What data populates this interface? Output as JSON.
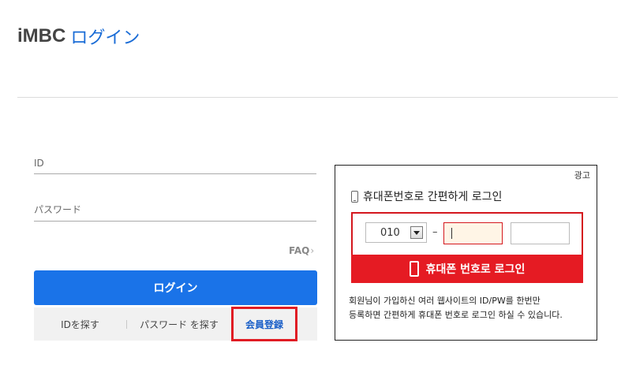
{
  "header": {
    "logo": "iMBC",
    "subtitle": "ログイン"
  },
  "login": {
    "id_placeholder": "ID",
    "password_placeholder": "パスワード",
    "faq": "FAQ",
    "faq_arrow": "›",
    "login_button": "ログイン"
  },
  "links": {
    "find_id": "IDを探す",
    "find_password": "パスワード を探す",
    "register": "会員登録"
  },
  "ad": {
    "label": "광고",
    "title": "휴대폰번호로 간편하게 로그인",
    "prefix_value": "010",
    "dash": "–",
    "button": "휴대폰 번호로 로그인",
    "description_line1": "회원님이 가입하신 여러 웹사이트의 ID/PW를 한번만",
    "description_line2": "등록하면 간편하게 휴대폰 번호로 로그인 하실 수 있습니다."
  }
}
